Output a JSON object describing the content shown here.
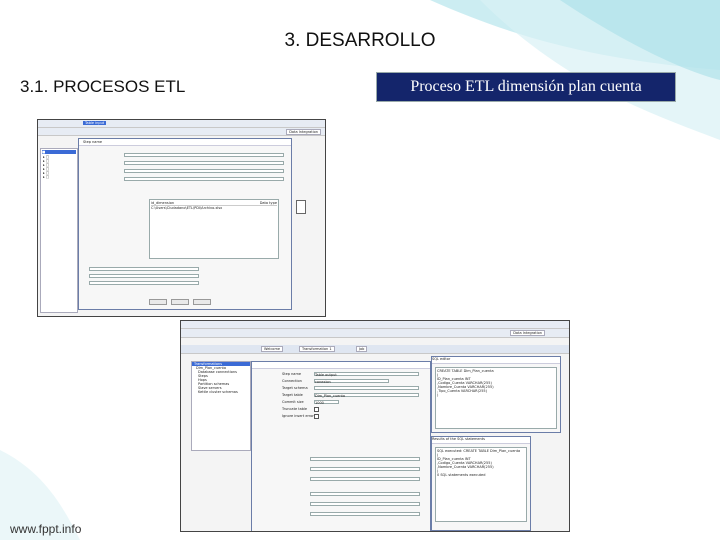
{
  "slide": {
    "title": "3. DESARROLLO",
    "subtitle": "3.1. PROCESOS ETL",
    "box_title": "Proceso ETL dimensión plan cuenta",
    "footer": "www.fppt.info"
  },
  "colors": {
    "title_box_bg": "#14256b",
    "wave_light": "#bfe8ef",
    "wave_mid": "#d8f1f5"
  },
  "screenshot1": {
    "top_path": "Table input",
    "right_tab": "Data Integration",
    "panel_row": "Step name",
    "column_header_a": "id_dimension",
    "column_header_b": "Data type",
    "row_value": "C:\\Users\\Ciudadano\\ETL\\PDI\\Archivo.xlsx"
  },
  "screenshot2": {
    "tabs": [
      "Welcome",
      "Transformation 1",
      "Job"
    ],
    "right_tab": "Data Integration",
    "tree_items": [
      "Transformations",
      "Dim_Plan_cuenta",
      "Database connections",
      "Steps",
      "Hops",
      "Partition schemas",
      "Slave servers",
      "Kettle cluster schemas"
    ],
    "form_labels": [
      "Step name",
      "Connection",
      "Target schema",
      "Target table",
      "Commit size",
      "Truncate table",
      "Ignore insert errors"
    ],
    "form_values": [
      "Table output",
      "conexion",
      "",
      "Dim_Plan_cuenta",
      "1000"
    ],
    "sql_dialog_title": "SQL editor",
    "sql_lines": [
      "CREATE TABLE Dim_Plan_cuenta",
      "(",
      "  ID_Plan_cuenta INT",
      "  ,Codigo_Cuenta VARCHAR(255)",
      "  ,Nombre_Cuenta VARCHAR(255)",
      "  ,Tipo_Cuenta VARCHAR(255)",
      ")"
    ],
    "results_dialog_title": "Results of the SQL statements",
    "results_lines": [
      "SQL executed: CREATE TABLE Dim_Plan_cuenta",
      "(",
      "  ID_Plan_cuenta INT",
      "  ,Codigo_Cuenta VARCHAR(255)",
      "  ,Nombre_Cuenta VARCHAR(255)",
      ")",
      "0 SQL statements executed"
    ]
  }
}
